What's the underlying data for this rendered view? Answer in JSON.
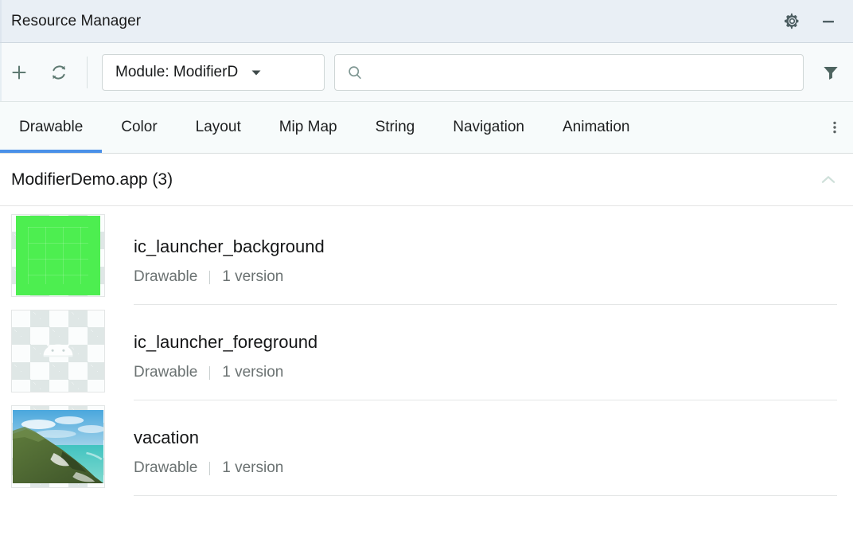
{
  "window": {
    "title": "Resource Manager",
    "settings_icon": "gear-icon",
    "minimize_icon": "minimize-icon"
  },
  "toolbar": {
    "add_icon": "plus-icon",
    "refresh_icon": "refresh-icon",
    "module_label": "Module: ModifierD",
    "module_caret_icon": "chevron-down-icon",
    "search_value": "",
    "search_placeholder": "",
    "search_icon": "search-icon",
    "filter_icon": "filter-icon"
  },
  "tabs": {
    "items": [
      {
        "label": "Drawable",
        "active": true
      },
      {
        "label": "Color",
        "active": false
      },
      {
        "label": "Layout",
        "active": false
      },
      {
        "label": "Mip Map",
        "active": false
      },
      {
        "label": "String",
        "active": false
      },
      {
        "label": "Navigation",
        "active": false
      },
      {
        "label": "Animation",
        "active": false
      }
    ],
    "overflow_icon": "more-vertical-icon",
    "active_underline_color": "#4a90e8"
  },
  "section": {
    "title": "ModifierDemo.app (3)",
    "collapse_icon": "chevron-up-icon"
  },
  "resources": [
    {
      "name": "ic_launcher_background",
      "type": "Drawable",
      "versions": "1 version",
      "thumbnail": "green-color-swatch",
      "color": "#4dee50"
    },
    {
      "name": "ic_launcher_foreground",
      "type": "Drawable",
      "versions": "1 version",
      "thumbnail": "android-robot-head-transparent"
    },
    {
      "name": "vacation",
      "type": "Drawable",
      "versions": "1 version",
      "thumbnail": "coastal-cliff-photo"
    }
  ]
}
